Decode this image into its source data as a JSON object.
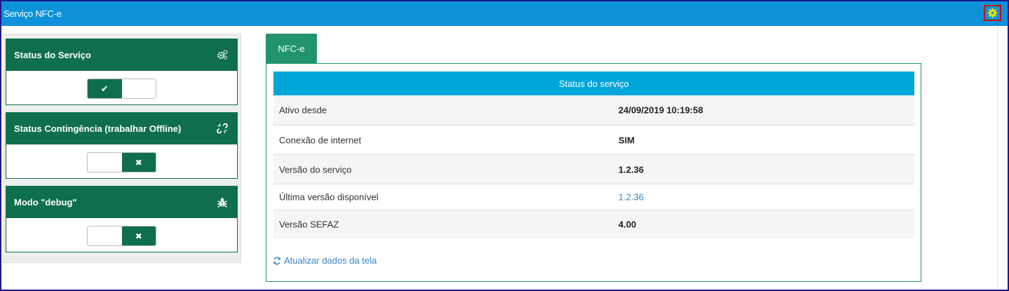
{
  "window": {
    "title": "Serviço NFC-e"
  },
  "icons": {
    "settings": "gear-icon"
  },
  "colors": {
    "titlebar": "#0d92d9",
    "panel_green": "#0e6e4d",
    "tab_green": "#21946b",
    "table_head": "#00a6d9",
    "link": "#3a83c3",
    "highlight_border": "#d40000"
  },
  "sidebar": {
    "panels": [
      {
        "title": "Status do Serviço",
        "icon": "gears-icon",
        "toggle_on": true,
        "toggle_glyph": "✔"
      },
      {
        "title": "Status Contingência (trabalhar Offline)",
        "icon": "unlink-icon",
        "toggle_on": false,
        "toggle_glyph": "✖"
      },
      {
        "title": "Modo \"debug\"",
        "icon": "bug-icon",
        "toggle_on": false,
        "toggle_glyph": "✖"
      }
    ]
  },
  "main": {
    "tab_label": "NFC-e",
    "table": {
      "heading": "Status do serviço",
      "rows": [
        {
          "label": "Ativo desde",
          "value": "24/09/2019 10:19:58"
        },
        {
          "label": "Conexão de internet",
          "value": "SIM"
        },
        {
          "label": "Versão do serviço",
          "value": "1.2.36"
        },
        {
          "label": "Última versão disponível",
          "value": "1.2.36"
        },
        {
          "label": "Versão SEFAZ",
          "value": "4.00"
        }
      ]
    },
    "refresh_label": "Atualizar dados da tela"
  }
}
